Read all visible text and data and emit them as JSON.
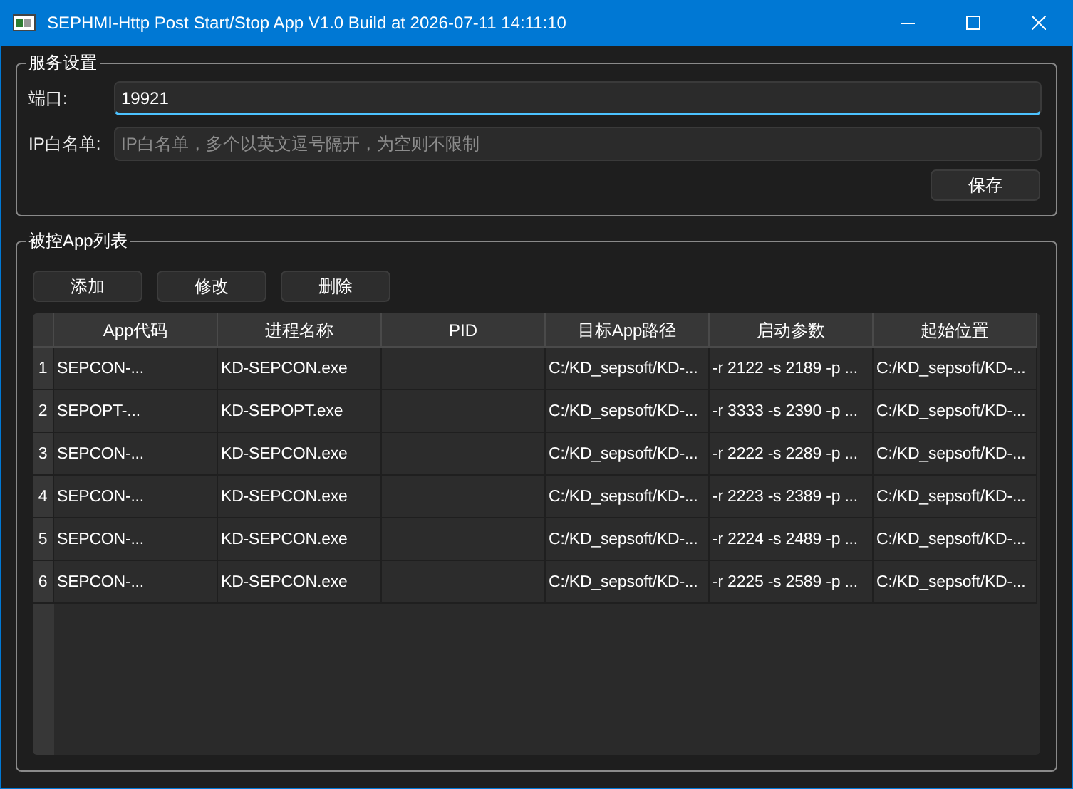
{
  "window": {
    "title": "SEPHMI-Http Post Start/Stop App V1.0 Build at 2026-07-11 14:11:10"
  },
  "service_settings": {
    "title": "服务设置",
    "fields": [
      {
        "label": "端口:",
        "value": "19921",
        "focused": true
      },
      {
        "label": "IP白名单:",
        "placeholder": "IP白名单，多个以英文逗号隔开，为空则不限制",
        "focused": false
      }
    ],
    "save_button": "保存"
  },
  "app_list": {
    "title": "被控App列表",
    "buttons": [
      "添加",
      "修改",
      "删除"
    ],
    "table": {
      "columns": [
        "App代码",
        "进程名称",
        "PID",
        "目标App路径",
        "启动参数",
        "起始位置"
      ],
      "rows": [
        {
          "index": "1",
          "cells": [
            "SEPCON-...",
            "KD-SEPCON.exe",
            null,
            "C:/KD_sepsoft/KD-...",
            "-r 2122 -s 2189 -p ...",
            "C:/KD_sepsoft/KD-..."
          ]
        },
        {
          "index": "2",
          "cells": [
            "SEPOPT-...",
            "KD-SEPOPT.exe",
            null,
            "C:/KD_sepsoft/KD-...",
            "-r 3333 -s 2390 -p ...",
            "C:/KD_sepsoft/KD-..."
          ]
        },
        {
          "index": "3",
          "cells": [
            "SEPCON-...",
            "KD-SEPCON.exe",
            null,
            "C:/KD_sepsoft/KD-...",
            "-r 2222 -s 2289 -p ...",
            "C:/KD_sepsoft/KD-..."
          ]
        },
        {
          "index": "4",
          "cells": [
            "SEPCON-...",
            "KD-SEPCON.exe",
            null,
            "C:/KD_sepsoft/KD-...",
            "-r 2223 -s 2389 -p ...",
            "C:/KD_sepsoft/KD-..."
          ]
        },
        {
          "index": "5",
          "cells": [
            "SEPCON-...",
            "KD-SEPCON.exe",
            null,
            "C:/KD_sepsoft/KD-...",
            "-r 2224 -s 2489 -p ...",
            "C:/KD_sepsoft/KD-..."
          ]
        },
        {
          "index": "6",
          "cells": [
            "SEPCON-...",
            "KD-SEPCON.exe",
            null,
            "C:/KD_sepsoft/KD-...",
            "-r 2225 -s 2589 -p ...",
            "C:/KD_sepsoft/KD-..."
          ]
        }
      ]
    }
  }
}
